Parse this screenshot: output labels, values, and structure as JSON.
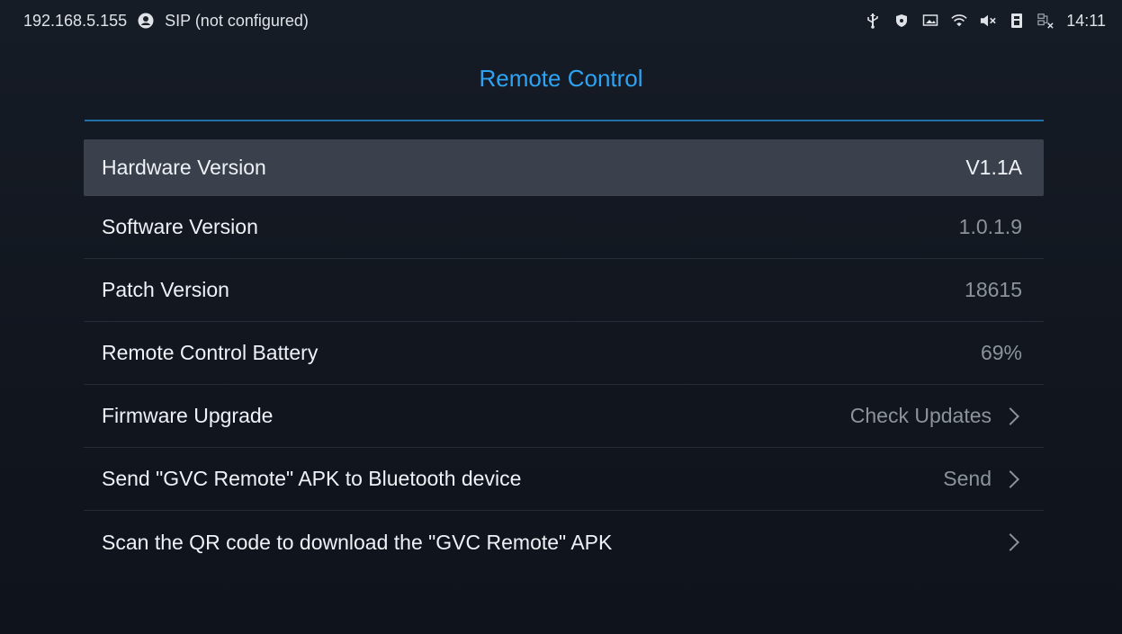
{
  "statusbar": {
    "ip": "192.168.5.155",
    "sip_status": "SIP (not configured)",
    "time": "14:11",
    "icons": [
      "usb-icon",
      "shield-icon",
      "screen-icon",
      "wifi-icon",
      "muted-speaker-icon",
      "sim-icon",
      "ethernet-disconnected-icon"
    ]
  },
  "page": {
    "title": "Remote Control"
  },
  "accent_color": "#2ea3f2",
  "rows": [
    {
      "label": "Hardware Version",
      "value": "V1.1A"
    },
    {
      "label": "Software Version",
      "value": "1.0.1.9"
    },
    {
      "label": "Patch Version",
      "value": "18615"
    },
    {
      "label": "Remote Control Battery",
      "value": "69%"
    },
    {
      "label": "Firmware Upgrade",
      "value": "Check Updates"
    },
    {
      "label": "Send \"GVC Remote\" APK to Bluetooth device",
      "value": "Send"
    },
    {
      "label": "Scan the QR code to download the \"GVC Remote\" APK",
      "value": ""
    }
  ]
}
